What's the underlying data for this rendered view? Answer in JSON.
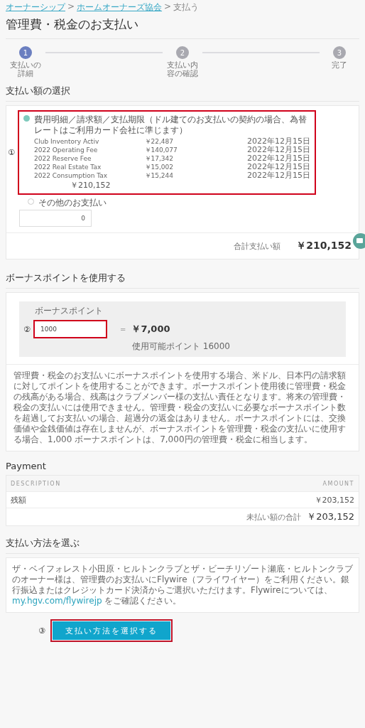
{
  "breadcrumb": [
    {
      "label": "オーナーシップ",
      "link": true
    },
    {
      "label": "ホームオーナーズ協会",
      "link": true
    },
    {
      "label": "支払う",
      "link": false
    }
  ],
  "breadcrumb_separators": [
    ">",
    ">"
  ],
  "title": "管理費・税金のお支払い",
  "steps": [
    {
      "number": "1",
      "label": "支払いの詳細",
      "active": true
    },
    {
      "number": "2",
      "label": "支払い内容の確認",
      "active": false
    },
    {
      "number": "3",
      "label": "完了",
      "active": false
    }
  ],
  "amount_section": {
    "heading": "支払い額の選択",
    "annotation": "①",
    "options": [
      {
        "kind": "itemized",
        "label": "費用明細／請求額／支払期限（ドル建てのお支払いの契約の場合、為替レートはご利用カード会社に準じます）",
        "selected": true,
        "items": [
          {
            "description": "Club Inventory Activ",
            "amount": "￥22,487",
            "due": "2022年12月15日"
          },
          {
            "description": "2022 Operating Fee",
            "amount": "￥140,077",
            "due": "2022年12月15日"
          },
          {
            "description": "2022 Reserve Fee",
            "amount": "￥17,342",
            "due": "2022年12月15日"
          },
          {
            "description": "2022 Real Estate Tax",
            "amount": "￥15,002",
            "due": "2022年12月15日"
          },
          {
            "description": "2022 Consumption Tax",
            "amount": "￥15,244",
            "due": "2022年12月15日"
          }
        ],
        "subtotal": "￥210,152"
      },
      {
        "kind": "custom",
        "label": "その他のお支払い",
        "selected": false,
        "value": "0"
      }
    ],
    "total_label": "合計支払い額",
    "total": "￥210,152"
  },
  "bonus_section": {
    "heading": "ボーナスポイントを使用する",
    "annotation": "②",
    "field_label": "ボーナスポイント",
    "value": "1000",
    "equals": "=",
    "converted": "￥7,000",
    "available": "使用可能ポイント 16000",
    "note": "管理費・税金のお支払いにボーナスポイントを使用する場合、米ドル、日本円の請求額に対してポイントを使用することができます。ボーナスポイント使用後に管理費・税金の残高がある場合、残高はクラブメンバー様の支払い責任となります。将来の管理費・税金の支払いには使用できません。管理費・税金の支払いに必要なボーナスポイント数を超過してお支払いの場合、超過分の返金はありません。ボーナスポイントには、交換価値や金銭価値は存在しませんが、ボーナスポイントを管理費・税金の支払いに使用する場合、1,000 ボーナスポイントは、7,000円の管理費・税金に相当します。"
  },
  "payment_section": {
    "heading": "Payment",
    "columns": [
      "DESCRIPTION",
      "AMOUNT"
    ],
    "rows": [
      {
        "description": "残額",
        "amount": "￥203,152"
      }
    ],
    "total_label": "未払い額の合計",
    "total": "￥203,152"
  },
  "method_section": {
    "heading": "支払い方法を選ぶ",
    "annotation": "③",
    "note_before": "ザ・ベイフォレスト小田原・ヒルトンクラブとザ・ビーチリゾート瀬底・ヒルトンクラブのオーナー様は、管理費のお支払いにFlywire（フライワイヤー）をご利用ください。銀行振込またはクレジットカード決済からご選択いただけます。Flywireについては、",
    "note_link": "my.hgv.com/flywirejp",
    "note_after": " をご確認ください。",
    "button": "支払い方法を選択する"
  }
}
